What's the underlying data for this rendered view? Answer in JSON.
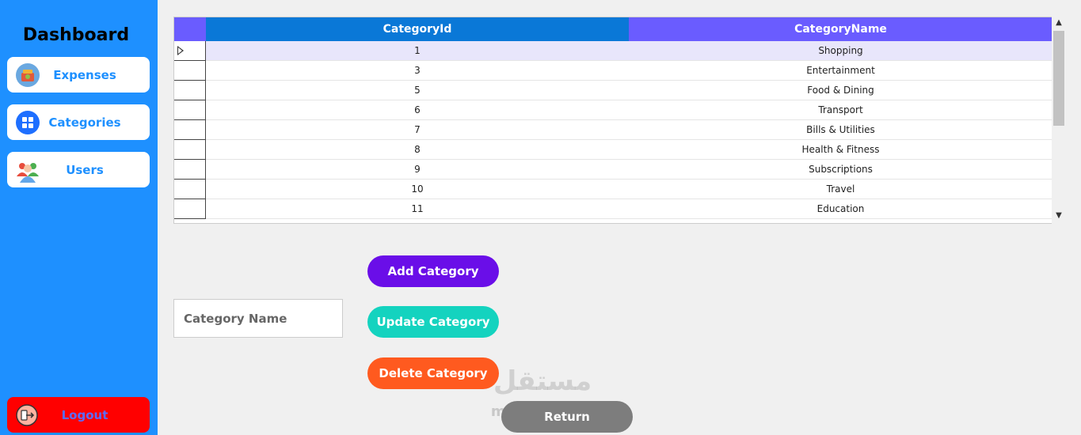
{
  "sidebar": {
    "title": "Dashboard",
    "items": [
      {
        "label": "Expenses",
        "icon": "expenses-icon"
      },
      {
        "label": "Categories",
        "icon": "categories-grid-icon"
      },
      {
        "label": "Users",
        "icon": "users-icon"
      }
    ],
    "logout": {
      "label": "Logout",
      "icon": "logout-icon"
    }
  },
  "grid": {
    "columns": [
      "CategoryId",
      "CategoryName"
    ],
    "rows": [
      {
        "id": "1",
        "name": "Shopping"
      },
      {
        "id": "3",
        "name": "Entertainment"
      },
      {
        "id": "5",
        "name": "Food & Dining"
      },
      {
        "id": "6",
        "name": "Transport"
      },
      {
        "id": "7",
        "name": "Bills & Utilities"
      },
      {
        "id": "8",
        "name": "Health & Fitness"
      },
      {
        "id": "9",
        "name": "Subscriptions"
      },
      {
        "id": "10",
        "name": "Travel"
      },
      {
        "id": "11",
        "name": "Education"
      }
    ],
    "selected_row": 0
  },
  "form": {
    "category_name_placeholder": "Category Name"
  },
  "buttons": {
    "add": "Add Category",
    "update": "Update Category",
    "delete": "Delete Category",
    "return": "Return"
  },
  "watermark": {
    "arabic": "مستقل",
    "latin": "mostaql.com"
  },
  "colors": {
    "sidebar": "#1e90ff",
    "header_id": "#0a78d7",
    "header_name": "#6a5cff",
    "add": "#6a0ee8",
    "update": "#14d3bf",
    "delete": "#ff5a1f",
    "return": "#7d7d7d",
    "logout": "#ff0000"
  }
}
